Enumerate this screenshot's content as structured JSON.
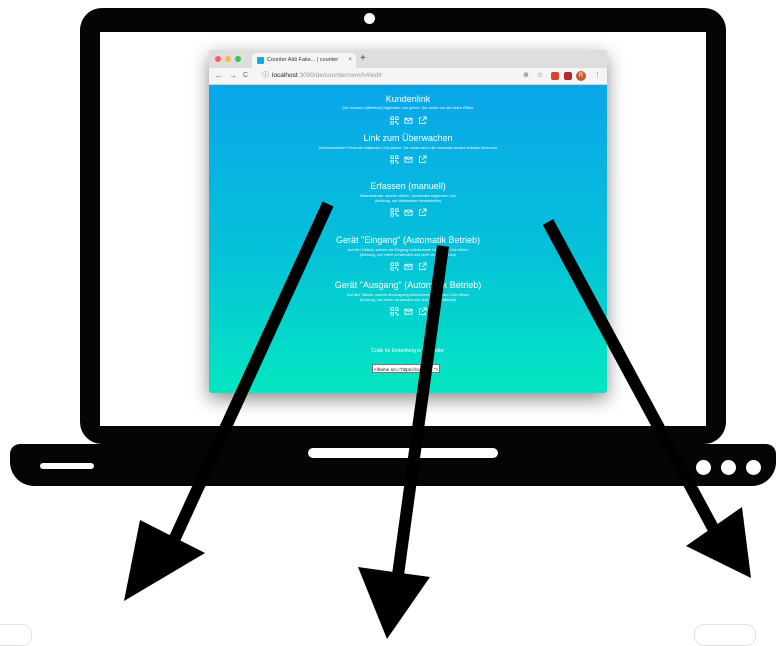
{
  "browser": {
    "tab_title": "Counter Aldi Fake... | counter",
    "tab_close": "×",
    "new_tab": "+",
    "nav_back": "←",
    "nav_forward": "→",
    "nav_reload": "C",
    "url_info_icon": "ⓘ",
    "url_host": "localhost",
    "url_path": ":3000/de/counter/own/h4/edit",
    "zoom_icon": "⊕",
    "star_icon": "☆",
    "avatar_letter": "R",
    "menu_icon": "⋮"
  },
  "sections": [
    {
      "title": "Kundenlink",
      "desc": "Den Kunden (öffentlich) folgenden Link geben. Sie sehen nur die freien Plätze",
      "desc2": ""
    },
    {
      "title": "Link zum Überwachen",
      "desc": "Überwachenden Personen folgenden Link geben. Sie sehen auch die maximale Anzahl erlaubte Besucher",
      "desc2": ""
    },
    {
      "title": "Erfassen (manuell)",
      "desc": "Mitarbeitende, welche zählen, verwenden folgenden Link",
      "desc2": "(Achtung, nur Mitarbeitern bereitstellen)"
    },
    {
      "title": "Gerät \"Eingang\" (Automatik Betrieb)",
      "desc": "Auf den Tablets, welche als Eingang funktionieren folgenden Link öffnen",
      "desc2": "(Achtung, nur Intern verwenden und nicht veröffentlichen)"
    },
    {
      "title": "Gerät \"Ausgang\" (Automatik Betrieb)",
      "desc": "Auf den Tablets, welche als Ausgang funktionieren folgenden Link öffnen",
      "desc2": "(Achtung, nur Intern verwenden und nicht veröffentlichen)"
    }
  ],
  "embed": {
    "label": "Code für Einbettung in Webseite:",
    "code": "<iframe src=\"https://counter...\">"
  },
  "colors": {
    "gradient_top": "#0aa6e9",
    "gradient_bottom": "#04e7c1",
    "traffic_red": "#fc605c",
    "traffic_yellow": "#fdbc40",
    "traffic_green": "#34c84a"
  },
  "icons": [
    "qr-code-icon",
    "mail-icon",
    "external-link-icon"
  ]
}
